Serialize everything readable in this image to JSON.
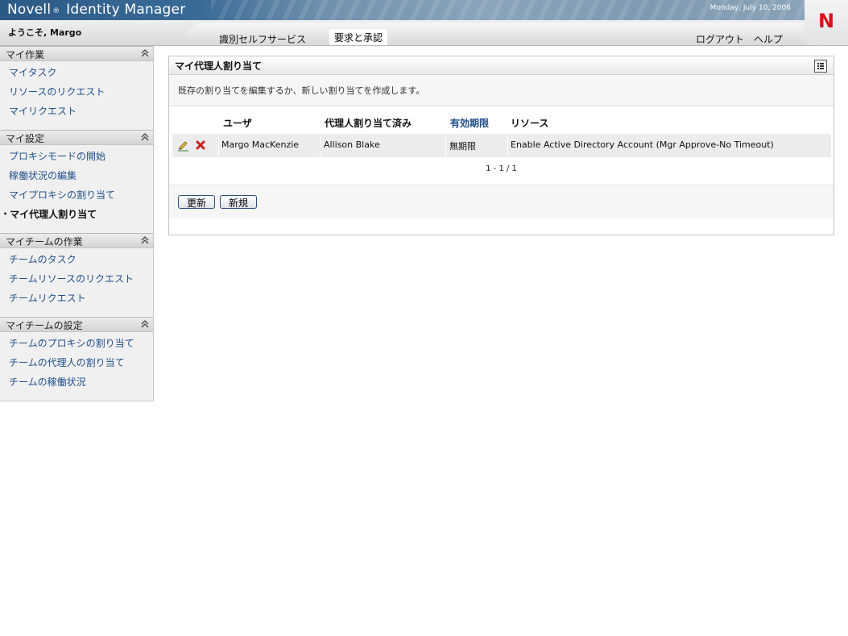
{
  "header": {
    "product_prefix": "Novell",
    "registered_mark": "®",
    "product_name": "Identity Manager",
    "date": "Monday, July 10, 2006",
    "welcome": "ようこそ, Margo",
    "logo_letter": "N"
  },
  "nav": {
    "tabs": [
      {
        "label": "識別セルフサービス",
        "active": false
      },
      {
        "label": "要求と承認",
        "active": true
      }
    ],
    "logout": "ログアウト",
    "help": "ヘルプ"
  },
  "sidebar": {
    "sections": [
      {
        "title": "マイ作業",
        "items": [
          "マイタスク",
          "リソースのリクエスト",
          "マイリクエスト"
        ]
      },
      {
        "title": "マイ設定",
        "items": [
          "プロキシモードの開始",
          "稼働状況の編集",
          "マイプロキシの割り当て"
        ],
        "current": "マイ代理人割り当て"
      },
      {
        "title": "マイチームの作業",
        "items": [
          "チームのタスク",
          "チームリソースのリクエスト",
          "チームリクエスト"
        ]
      },
      {
        "title": "マイチームの設定",
        "items": [
          "チームのプロキシの割り当て",
          "チームの代理人の割り当て",
          "チームの稼働状況"
        ]
      }
    ]
  },
  "panel": {
    "title": "マイ代理人割り当て",
    "description": "既存の割り当てを編集するか、新しい割り当てを作成します。",
    "columns": [
      "ユーザ",
      "代理人割り当て済み",
      "有効期限",
      "リソース"
    ],
    "rows": [
      {
        "user": "Margo MacKenzie",
        "delegate": "Allison Blake",
        "expiration": "無期限",
        "resource": "Enable Active Directory Account (Mgr Approve-No Timeout)"
      }
    ],
    "pager": "1 - 1 / 1",
    "refresh_label": "更新",
    "new_label": "新規"
  },
  "colors": {
    "link": "#1f4f8a",
    "delete": "#cc1f1f",
    "logo": "#d3121c",
    "banner": "#3a6b96"
  }
}
